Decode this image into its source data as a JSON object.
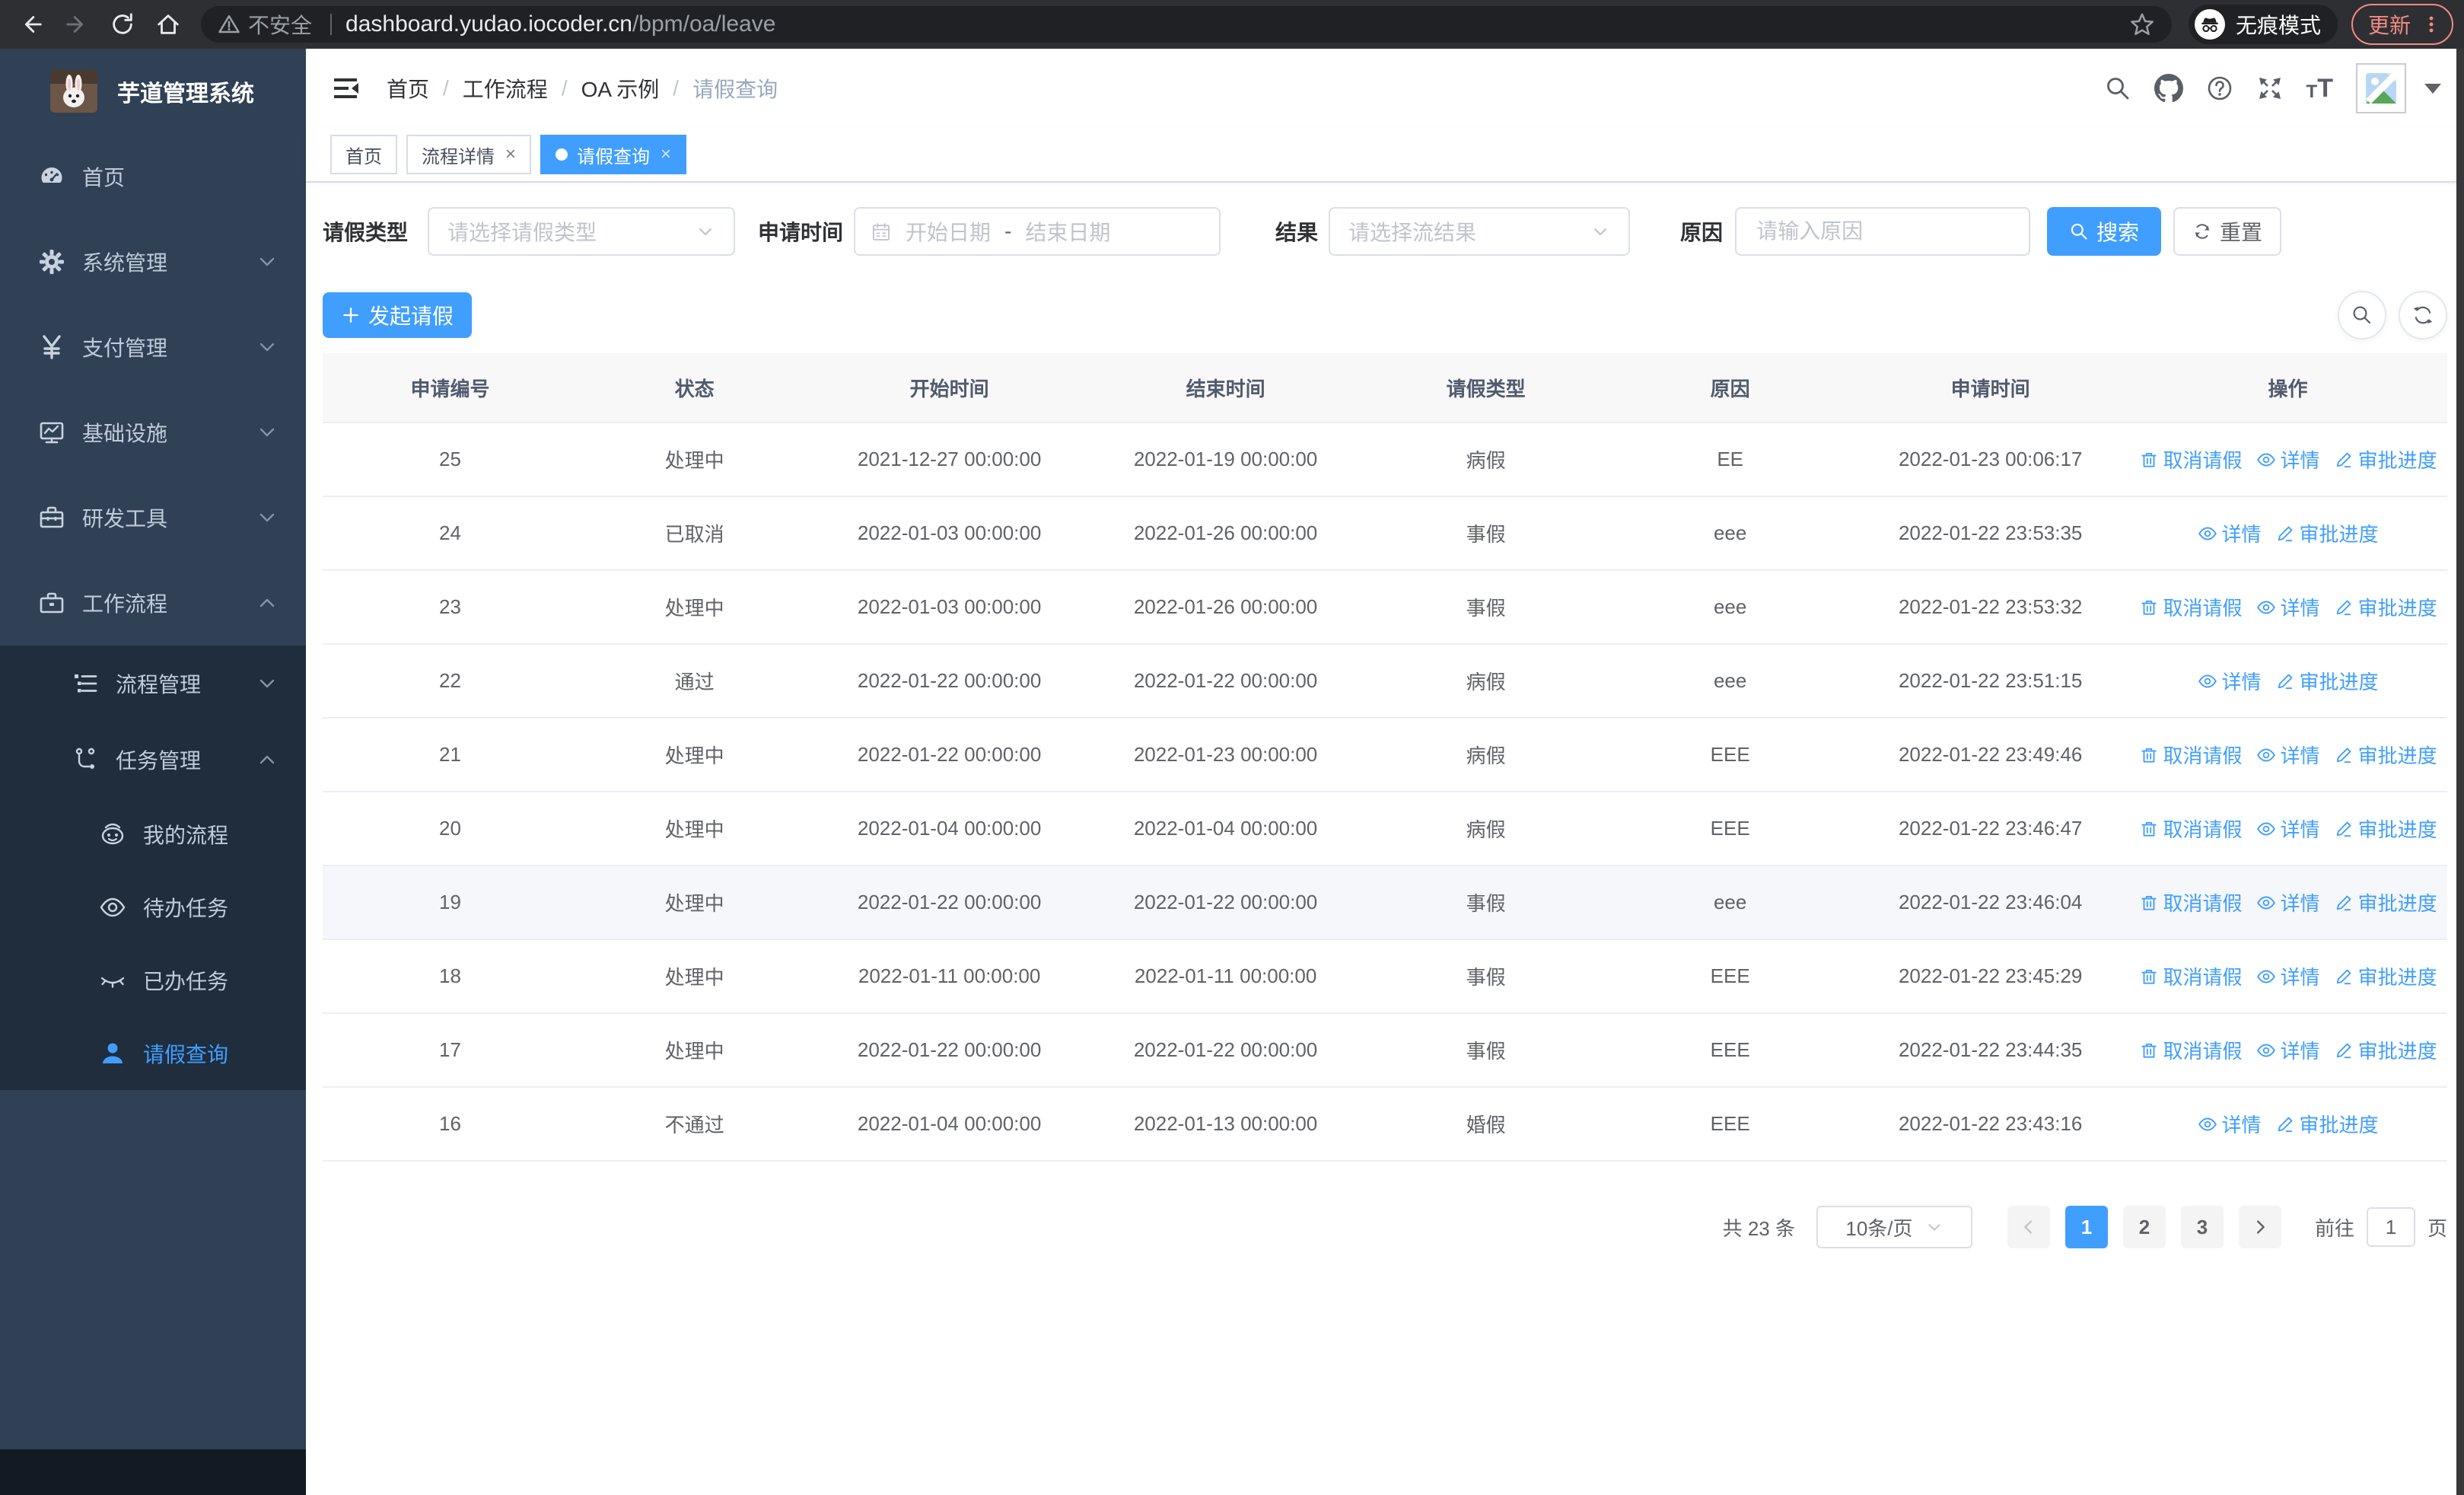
{
  "browser": {
    "security_label": "不安全",
    "url_host": "dashboard.yudao.iocoder.cn",
    "url_path": "/bpm/oa/leave",
    "incognito_label": "无痕模式",
    "update_label": "更新"
  },
  "sidebar": {
    "title": "芋道管理系统",
    "items": [
      {
        "label": "首页"
      },
      {
        "label": "系统管理"
      },
      {
        "label": "支付管理"
      },
      {
        "label": "基础设施"
      },
      {
        "label": "研发工具"
      },
      {
        "label": "工作流程"
      },
      {
        "label": "流程管理"
      },
      {
        "label": "任务管理"
      },
      {
        "label": "我的流程"
      },
      {
        "label": "待办任务"
      },
      {
        "label": "已办任务"
      },
      {
        "label": "请假查询"
      }
    ]
  },
  "breadcrumb": {
    "separator": "/",
    "items": [
      "首页",
      "工作流程",
      "OA 示例",
      "请假查询"
    ]
  },
  "tabs": [
    {
      "label": "首页"
    },
    {
      "label": "流程详情",
      "close": "×"
    },
    {
      "label": "请假查询",
      "close": "×"
    }
  ],
  "filters": {
    "leave_type_label": "请假类型",
    "leave_type_placeholder": "请选择请假类型",
    "apply_time_label": "申请时间",
    "start_date_placeholder": "开始日期",
    "date_separator": "-",
    "end_date_placeholder": "结束日期",
    "result_label": "结果",
    "result_placeholder": "请选择流结果",
    "reason_label": "原因",
    "reason_placeholder": "请输入原因",
    "search_label": "搜索",
    "reset_label": "重置"
  },
  "toolbar": {
    "create_label": "发起请假"
  },
  "table": {
    "columns": [
      "申请编号",
      "状态",
      "开始时间",
      "结束时间",
      "请假类型",
      "原因",
      "申请时间",
      "操作"
    ],
    "action_labels": {
      "cancel": "取消请假",
      "detail": "详情",
      "progress": "审批进度"
    },
    "rows": [
      {
        "id": "25",
        "status": "处理中",
        "start": "2021-12-27 00:00:00",
        "end": "2022-01-19 00:00:00",
        "type": "病假",
        "reason": "EE",
        "applied": "2022-01-23 00:06:17",
        "cancellable": true,
        "highlight": false
      },
      {
        "id": "24",
        "status": "已取消",
        "start": "2022-01-03 00:00:00",
        "end": "2022-01-26 00:00:00",
        "type": "事假",
        "reason": "eee",
        "applied": "2022-01-22 23:53:35",
        "cancellable": false,
        "highlight": false
      },
      {
        "id": "23",
        "status": "处理中",
        "start": "2022-01-03 00:00:00",
        "end": "2022-01-26 00:00:00",
        "type": "事假",
        "reason": "eee",
        "applied": "2022-01-22 23:53:32",
        "cancellable": true,
        "highlight": false
      },
      {
        "id": "22",
        "status": "通过",
        "start": "2022-01-22 00:00:00",
        "end": "2022-01-22 00:00:00",
        "type": "病假",
        "reason": "eee",
        "applied": "2022-01-22 23:51:15",
        "cancellable": false,
        "highlight": false
      },
      {
        "id": "21",
        "status": "处理中",
        "start": "2022-01-22 00:00:00",
        "end": "2022-01-23 00:00:00",
        "type": "病假",
        "reason": "EEE",
        "applied": "2022-01-22 23:49:46",
        "cancellable": true,
        "highlight": false
      },
      {
        "id": "20",
        "status": "处理中",
        "start": "2022-01-04 00:00:00",
        "end": "2022-01-04 00:00:00",
        "type": "病假",
        "reason": "EEE",
        "applied": "2022-01-22 23:46:47",
        "cancellable": true,
        "highlight": false
      },
      {
        "id": "19",
        "status": "处理中",
        "start": "2022-01-22 00:00:00",
        "end": "2022-01-22 00:00:00",
        "type": "事假",
        "reason": "eee",
        "applied": "2022-01-22 23:46:04",
        "cancellable": true,
        "highlight": true
      },
      {
        "id": "18",
        "status": "处理中",
        "start": "2022-01-11 00:00:00",
        "end": "2022-01-11 00:00:00",
        "type": "事假",
        "reason": "EEE",
        "applied": "2022-01-22 23:45:29",
        "cancellable": true,
        "highlight": false
      },
      {
        "id": "17",
        "status": "处理中",
        "start": "2022-01-22 00:00:00",
        "end": "2022-01-22 00:00:00",
        "type": "事假",
        "reason": "EEE",
        "applied": "2022-01-22 23:44:35",
        "cancellable": true,
        "highlight": false
      },
      {
        "id": "16",
        "status": "不通过",
        "start": "2022-01-04 00:00:00",
        "end": "2022-01-13 00:00:00",
        "type": "婚假",
        "reason": "EEE",
        "applied": "2022-01-22 23:43:16",
        "cancellable": false,
        "highlight": false
      }
    ]
  },
  "pagination": {
    "total_label": "共 23 条",
    "page_size": "10条/页",
    "pages": [
      "1",
      "2",
      "3"
    ],
    "active_page": "1",
    "goto_label": "前往",
    "goto_value": "1",
    "page_label": "页"
  },
  "colors": {
    "accent": "#409eff",
    "sidebar_bg": "#304156",
    "submenu_bg": "#1f2d3d",
    "sidebar_text": "#bfcbd9",
    "update_accent": "#f28b82",
    "table_header_bg": "#f8f8f9",
    "table_text": "#606266",
    "border": "#ebeef5"
  }
}
